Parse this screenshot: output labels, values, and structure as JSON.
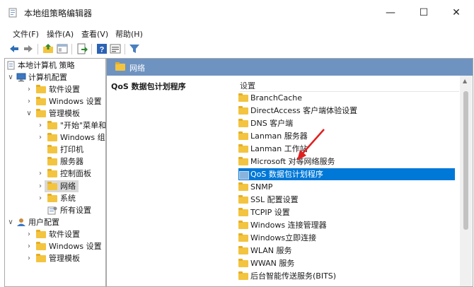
{
  "window": {
    "title": "本地组策略编辑器",
    "minimize": "—",
    "maximize": "☐",
    "close": "✕"
  },
  "menu": [
    "文件(F)",
    "操作(A)",
    "查看(V)",
    "帮助(H)"
  ],
  "toolbar": {
    "icons": [
      "back-arrow-icon",
      "forward-arrow-icon",
      "up-folder-icon",
      "show-tree-icon",
      "export-icon",
      "help-icon",
      "properties-icon",
      "filter-icon"
    ]
  },
  "tree": [
    {
      "label": "本地计算机 策略",
      "icon": "computer-policy-icon"
    },
    {
      "label": "计算机配置",
      "icon": "computer-icon"
    },
    {
      "label": "软件设置"
    },
    {
      "label": "Windows 设置"
    },
    {
      "label": "管理模板"
    },
    {
      "label": "\"开始\"菜单和"
    },
    {
      "label": "Windows 组"
    },
    {
      "label": "打印机"
    },
    {
      "label": "服务器"
    },
    {
      "label": "控制面板"
    },
    {
      "label": "网络",
      "selected": true
    },
    {
      "label": "系统"
    },
    {
      "label": "所有设置",
      "icon": "all-settings-icon"
    },
    {
      "label": "用户配置",
      "icon": "user-icon"
    },
    {
      "label": "软件设置"
    },
    {
      "label": "Windows 设置"
    },
    {
      "label": "管理模板"
    }
  ],
  "right_panel": {
    "header": "网络",
    "description_title": "QoS 数据包计划程序",
    "column_header": "设置",
    "items": [
      "BranchCache",
      "DirectAccess 客户端体验设置",
      "DNS 客户端",
      "Lanman 服务器",
      "Lanman 工作站",
      "Microsoft 对等网络服务",
      "QoS 数据包计划程序",
      "SNMP",
      "SSL 配置设置",
      "TCPIP 设置",
      "Windows 连接管理器",
      "Windows立即连接",
      "WLAN 服务",
      "WWAN 服务",
      "后台智能传送服务(BITS)"
    ],
    "selected_index": 6
  },
  "colors": {
    "header_bar": "#6f93c1",
    "selection": "#0078d7",
    "folder": "#f3c43f",
    "annotation_arrow": "#e02020"
  }
}
